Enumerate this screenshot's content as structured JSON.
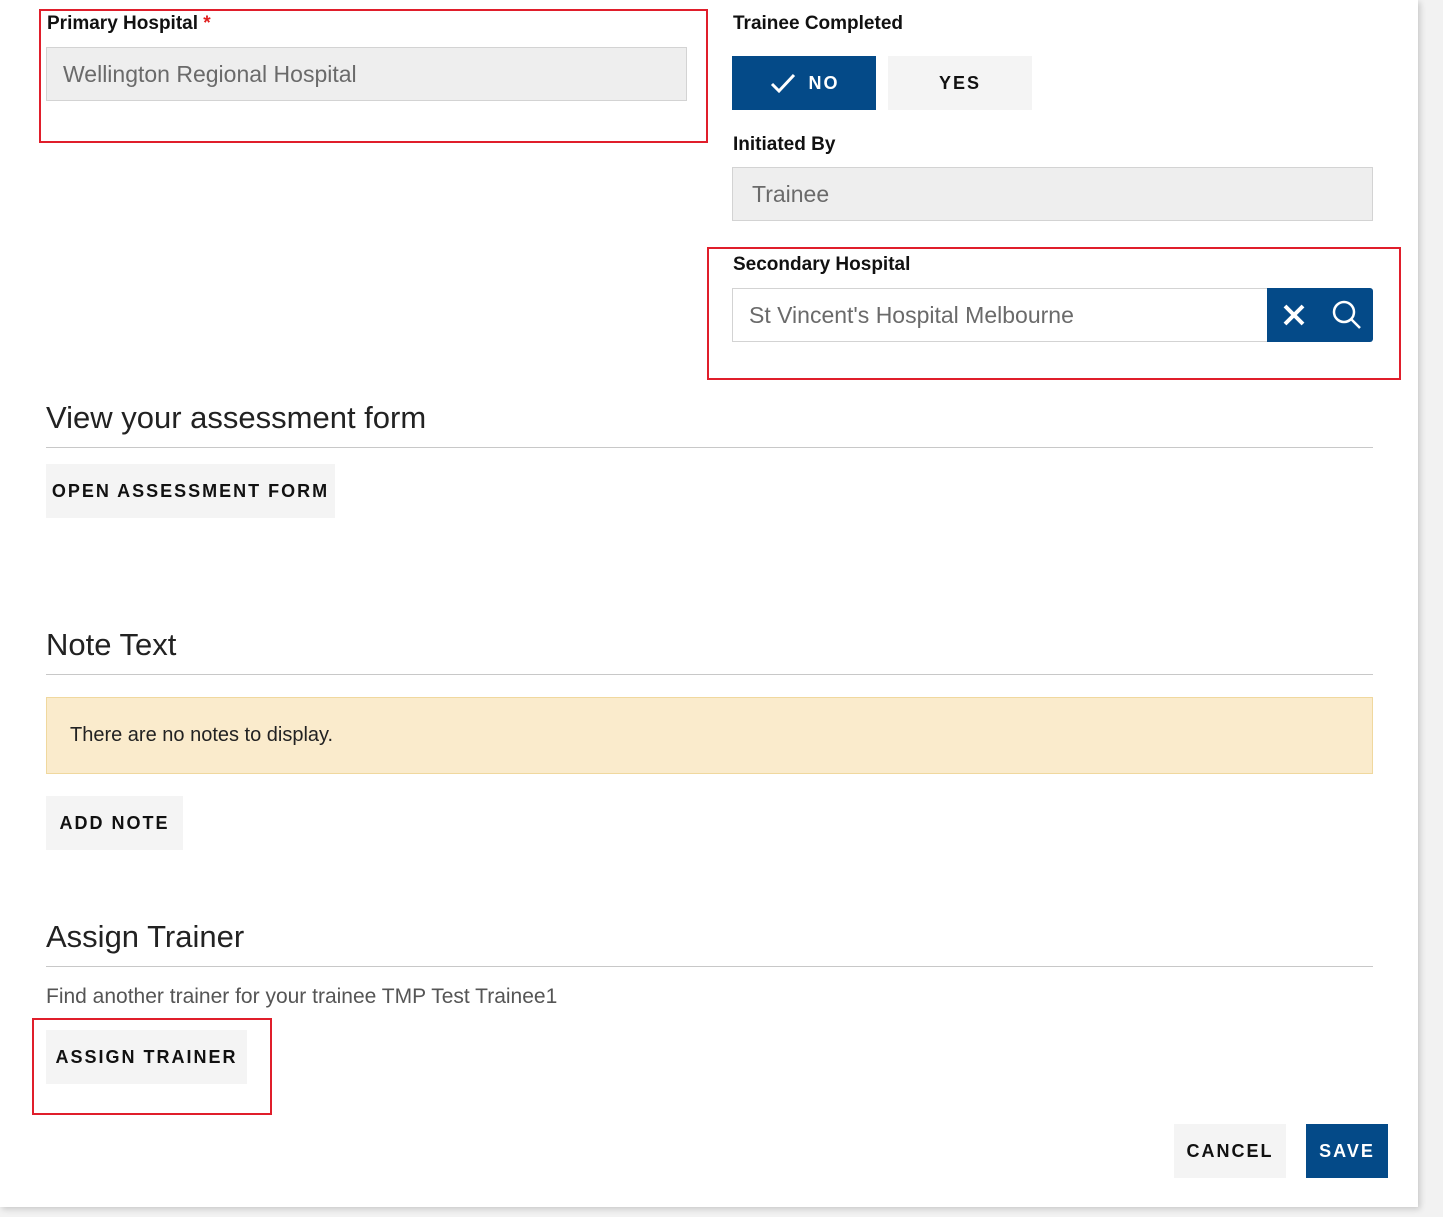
{
  "primary_hospital": {
    "label": "Primary Hospital",
    "required_marker": "*",
    "value": "Wellington Regional Hospital"
  },
  "trainee_completed": {
    "label": "Trainee Completed",
    "options": [
      {
        "label": "NO",
        "selected": true
      },
      {
        "label": "YES",
        "selected": false
      }
    ]
  },
  "initiated_by": {
    "label": "Initiated By",
    "value": "Trainee"
  },
  "secondary_hospital": {
    "label": "Secondary Hospital",
    "value": "St Vincent's Hospital Melbourne",
    "clear_icon": "close-icon",
    "search_icon": "search-icon"
  },
  "assessment_section": {
    "title": "View your assessment form",
    "button_label": "OPEN ASSESSMENT FORM"
  },
  "notes_section": {
    "title": "Note Text",
    "empty_message": "There are no notes to display.",
    "button_label": "ADD NOTE"
  },
  "assign_trainer_section": {
    "title": "Assign Trainer",
    "description": "Find another trainer for your trainee TMP Test Trainee1",
    "button_label": "ASSIGN TRAINER"
  },
  "footer": {
    "cancel_label": "CANCEL",
    "save_label": "SAVE"
  },
  "colors": {
    "primary": "#044a88",
    "highlight_box": "#e01e2b",
    "notice_bg": "#faebcc",
    "required": "#e01e1e"
  }
}
